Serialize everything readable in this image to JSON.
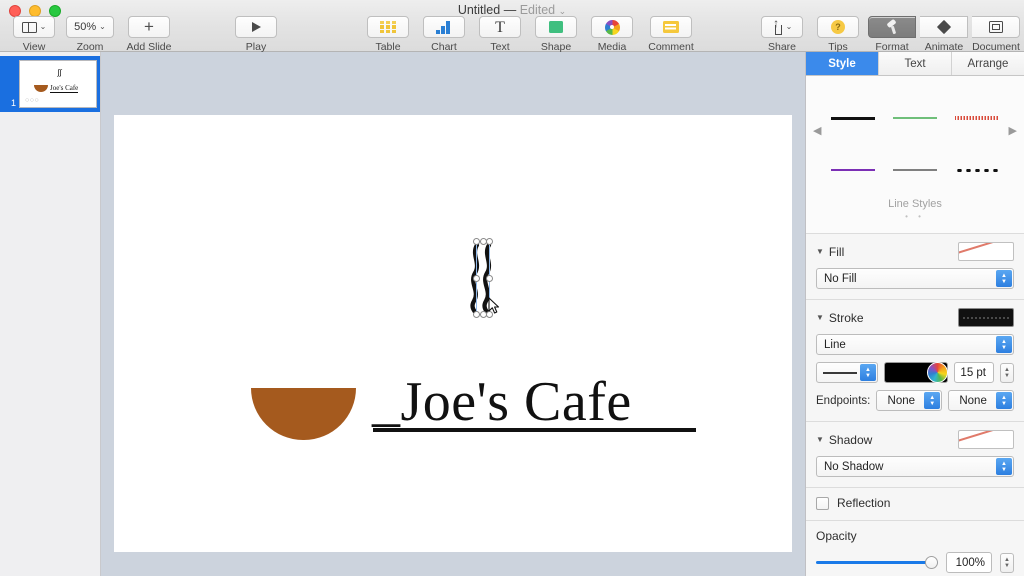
{
  "window": {
    "title": "Untitled",
    "separator": "—",
    "edited": "Edited",
    "chevron": "⌄"
  },
  "toolbar": {
    "left": [
      {
        "name": "view",
        "label": "View",
        "icon": "view-panel-icon",
        "chevron": "⌄"
      },
      {
        "name": "zoom",
        "label": "Zoom",
        "icon": "zoom-value",
        "value": "50%",
        "chevron": "⌄"
      },
      {
        "name": "add-slide",
        "label": "Add Slide",
        "icon": "plus-icon",
        "glyph": "+"
      }
    ],
    "play": {
      "label": "Play",
      "icon": "play-triangle-icon"
    },
    "insert": [
      {
        "name": "table",
        "label": "Table",
        "icon": "table-grid-icon"
      },
      {
        "name": "chart",
        "label": "Chart",
        "icon": "bar-chart-icon"
      },
      {
        "name": "text",
        "label": "Text",
        "icon": "text-t-icon",
        "glyph": "T"
      },
      {
        "name": "shape",
        "label": "Shape",
        "icon": "shape-square-icon"
      },
      {
        "name": "media",
        "label": "Media",
        "icon": "media-photos-icon"
      },
      {
        "name": "comment",
        "label": "Comment",
        "icon": "comment-note-icon"
      }
    ],
    "right": [
      {
        "name": "share",
        "label": "Share",
        "icon": "share-upload-icon",
        "chevron": "⌄"
      },
      {
        "name": "tips",
        "label": "Tips",
        "icon": "tips-question-icon",
        "glyph": "?"
      }
    ],
    "inspector_toggles": [
      {
        "name": "format",
        "label": "Format",
        "icon": "format-brush-icon",
        "active": true
      },
      {
        "name": "animate",
        "label": "Animate",
        "icon": "animate-diamond-icon",
        "active": false
      },
      {
        "name": "document",
        "label": "Document",
        "icon": "document-rect-icon",
        "active": false
      }
    ]
  },
  "navigator": {
    "slides": [
      {
        "number": "1",
        "selected": true,
        "thumb_title": "Joe's Cafe",
        "thumb_steam": "∫∫",
        "thumb_dots": "○○○"
      }
    ]
  },
  "slide": {
    "title": "_Joe's Cafe",
    "steam_shape": "steam-squiggle",
    "bowl_shape": "coffee-bowl-semicircle",
    "bowl_color": "#a55a1e",
    "underline_color": "#111111",
    "selection": {
      "handles": 8,
      "border_color": "#8fb8e8"
    }
  },
  "inspector": {
    "tabs": [
      {
        "label": "Style",
        "active": true
      },
      {
        "label": "Text",
        "active": false
      },
      {
        "label": "Arrange",
        "active": false
      }
    ],
    "gallery": {
      "caption": "Line Styles",
      "page_dots": "• •",
      "arrow_left": "◀",
      "arrow_right": "▶",
      "swatches": [
        {
          "name": "black-line",
          "style": "black"
        },
        {
          "name": "green-line",
          "style": "green"
        },
        {
          "name": "red-squiggle-line",
          "style": "red-squiggle"
        },
        {
          "name": "purple-line",
          "style": "purple"
        },
        {
          "name": "gray-line",
          "style": "gray"
        },
        {
          "name": "dotted-line",
          "style": "dotted"
        }
      ]
    },
    "fill": {
      "title": "Fill",
      "triangle": "▼",
      "value": "No Fill"
    },
    "stroke": {
      "title": "Stroke",
      "triangle": "▼",
      "type": "Line",
      "width": "15 pt",
      "color": "#000000",
      "endpoints_label": "Endpoints:",
      "endpoint_start": "None",
      "endpoint_end": "None"
    },
    "shadow": {
      "title": "Shadow",
      "triangle": "▼",
      "value": "No Shadow"
    },
    "reflection": {
      "label": "Reflection",
      "checked": false
    },
    "opacity": {
      "label": "Opacity",
      "value": "100%",
      "percent": 100
    }
  },
  "colors": {
    "accent_blue": "#3b8aeb",
    "selection_blue": "#1a6fe0",
    "canvas_bg": "#ccd3dd",
    "brown": "#a55a1e"
  }
}
